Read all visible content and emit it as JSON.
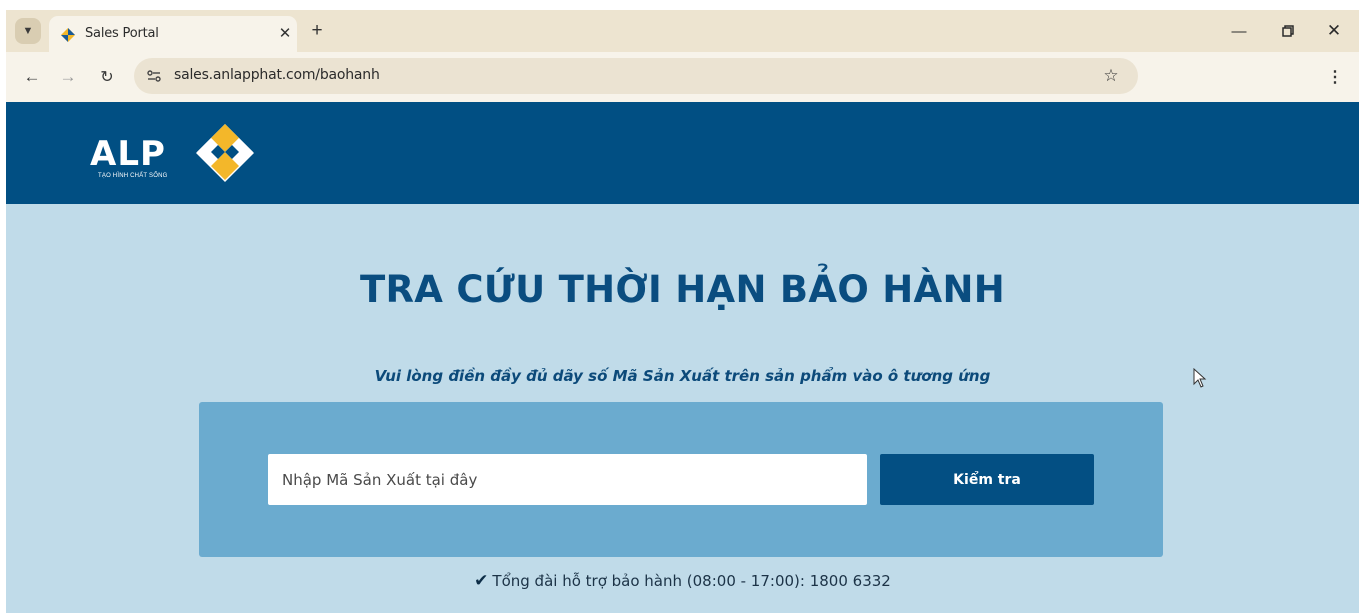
{
  "browser": {
    "tab_title": "Sales Portal",
    "url": "sales.anlapphat.com/baohanh",
    "icons": {
      "tab_list": "chevron-down-icon",
      "close_tab": "close-icon",
      "new_tab": "plus-icon",
      "back": "arrow-left-icon",
      "forward": "arrow-right-icon",
      "reload": "reload-icon",
      "site_info": "tune-icon",
      "bookmark": "star-icon",
      "menu": "kebab-menu-icon",
      "minimize": "minimize-icon",
      "restore": "restore-icon",
      "close_window": "close-icon"
    }
  },
  "header": {
    "logo_text": "ALP",
    "logo_tagline": "TẠO HÌNH CHẤT SỐNG",
    "colors": {
      "background": "#014f83",
      "logo_yellow": "#f3b72a"
    }
  },
  "main": {
    "title": "TRA CỨU THỜI HẠN BẢO HÀNH",
    "instruction": "Vui lòng điền đầy đủ dãy số Mã Sản Xuất trên sản phẩm vào ô tương ứng",
    "search": {
      "placeholder": "Nhập Mã Sản Xuất tại đây",
      "value": "",
      "button_label": "Kiểm tra"
    },
    "hotline": "Tổng đài hỗ trợ bảo hành (08:00 - 17:00): 1800 6332",
    "colors": {
      "page_bg": "#c0dbe9",
      "panel_bg": "#6babcf",
      "accent": "#034f83",
      "title": "#0a4d80"
    }
  }
}
